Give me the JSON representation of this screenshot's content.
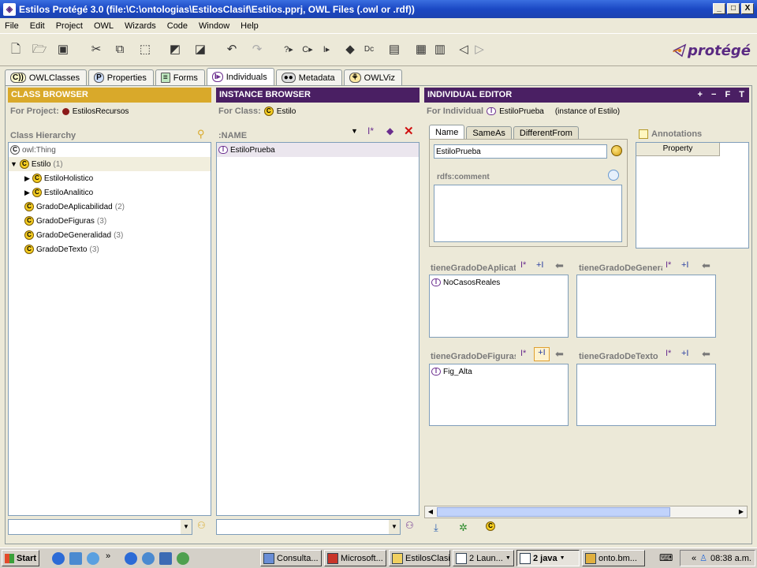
{
  "window": {
    "title": "Estilos  Protégé 3.0    (file:\\C:\\ontologias\\EstilosClasif\\Estilos.pprj, OWL Files (.owl or .rdf))",
    "buttons": [
      "_",
      "□",
      "X"
    ]
  },
  "menu": [
    "File",
    "Edit",
    "Project",
    "OWL",
    "Wizards",
    "Code",
    "Window",
    "Help"
  ],
  "logo": {
    "text": "protégé",
    "color": "#5a2a82"
  },
  "tabs": [
    {
      "label": "OWLClasses",
      "icon": "owl-classes-icon"
    },
    {
      "label": "Properties",
      "icon": "properties-icon"
    },
    {
      "label": "Forms",
      "icon": "forms-icon"
    },
    {
      "label": "Individuals",
      "icon": "individuals-icon"
    },
    {
      "label": "Metadata",
      "icon": "metadata-icon"
    },
    {
      "label": "OWLViz",
      "icon": "owlviz-icon"
    }
  ],
  "class_browser": {
    "header": "CLASS BROWSER",
    "project_label": "For Project:",
    "project_name": "EstilosRecursos",
    "hierarchy_label": "Class Hierarchy",
    "root": "owl:Thing",
    "items": [
      {
        "name": "Estilo",
        "count": "(1)"
      },
      {
        "name": "EstiloHolistico",
        "count": ""
      },
      {
        "name": "EstiloAnalitico",
        "count": ""
      },
      {
        "name": "GradoDeAplicabilidad",
        "count": "(2)"
      },
      {
        "name": "GradoDeFiguras",
        "count": "(3)"
      },
      {
        "name": "GradoDeGeneralidad",
        "count": "(3)"
      },
      {
        "name": "GradoDeTexto",
        "count": "(3)"
      }
    ],
    "header_color": "#d9a92a"
  },
  "instance_browser": {
    "header": "INSTANCE BROWSER",
    "class_label": "For Class:",
    "class_name": "Estilo",
    "column": ":NAME",
    "instances": [
      "EstiloPrueba"
    ],
    "header_color": "#4a1f63"
  },
  "individual_editor": {
    "header": "INDIVIDUAL EDITOR",
    "header_buttons": [
      "+",
      "−",
      "F",
      "T"
    ],
    "individual_label": "For Individual",
    "individual_name": "EstiloPrueba",
    "instance_of": "(instance of Estilo)",
    "subtabs": [
      "Name",
      "SameAs",
      "DifferentFrom"
    ],
    "name_value": "EstiloPrueba",
    "comment_label": "rdfs:comment",
    "annotations_label": "Annotations",
    "property_column": "Property",
    "slots": [
      {
        "label": "tieneGradoDeAplicat",
        "values": [
          "NoCasosReales"
        ]
      },
      {
        "label": "tieneGradoDeGenera",
        "values": []
      },
      {
        "label": "tieneGradoDeFiguras",
        "values": [
          "Fig_Alta"
        ]
      },
      {
        "label": "tieneGradoDeTexto",
        "values": []
      }
    ]
  },
  "taskbar": {
    "start": "Start",
    "tasks": [
      "Consulta...",
      "Microsoft...",
      "EstilosClasif",
      "2 Laun...",
      "2 java",
      "onto.bm..."
    ],
    "clock": "08:38 a.m."
  }
}
